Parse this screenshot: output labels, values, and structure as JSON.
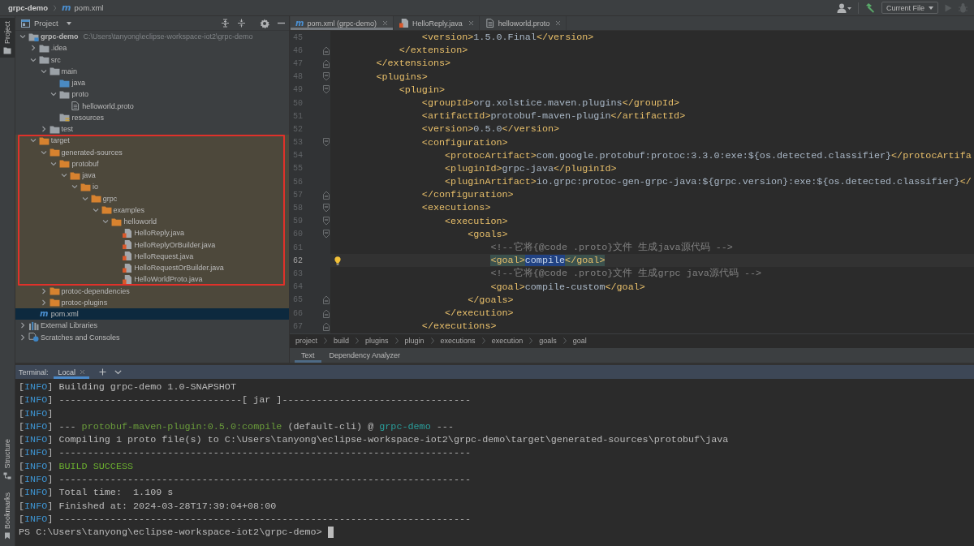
{
  "nav_bar": {
    "project": "grpc-demo",
    "file_glyph": "m",
    "file": "pom.xml",
    "run_configuration": "Current File"
  },
  "tool_stripe": {
    "top": [
      {
        "label": "Project",
        "kind": "project",
        "selected": true
      }
    ],
    "bottom": [
      {
        "label": "Structure",
        "kind": "structure",
        "selected": false
      },
      {
        "label": "Bookmarks",
        "kind": "bookmarks",
        "selected": false
      }
    ]
  },
  "project_panel": {
    "title": "Project",
    "tree": [
      {
        "label": "grpc-demo",
        "kind": "module",
        "hint": "C:\\Users\\tanyong\\eclipse-workspace-iot2\\grpc-demo",
        "expanded": true,
        "selected": false,
        "outlined": false,
        "children": [
          {
            "label": ".idea",
            "kind": "folder",
            "expanded": false,
            "selected": false,
            "outlined": false
          },
          {
            "label": "src",
            "kind": "folder",
            "expanded": true,
            "selected": false,
            "outlined": false,
            "children": [
              {
                "label": "main",
                "kind": "folder",
                "expanded": true,
                "selected": false,
                "outlined": false,
                "children": [
                  {
                    "label": "java",
                    "kind": "source_folder",
                    "selected": false,
                    "outlined": false
                  },
                  {
                    "label": "proto",
                    "kind": "folder",
                    "expanded": true,
                    "selected": false,
                    "outlined": false,
                    "children": [
                      {
                        "label": "helloworld.proto",
                        "kind": "proto_file",
                        "selected": false,
                        "outlined": false
                      }
                    ]
                  },
                  {
                    "label": "resources",
                    "kind": "resource_folder",
                    "selected": false,
                    "outlined": false
                  }
                ]
              },
              {
                "label": "test",
                "kind": "folder",
                "expanded": false,
                "selected": false,
                "outlined": false
              }
            ]
          },
          {
            "label": "target",
            "kind": "excluded_folder",
            "expanded": true,
            "selected": false,
            "outlined": true,
            "children": [
              {
                "label": "generated-sources",
                "kind": "folder",
                "expanded": true,
                "selected": false,
                "outlined": true,
                "children": [
                  {
                    "label": "protobuf",
                    "kind": "folder",
                    "expanded": true,
                    "selected": false,
                    "outlined": true,
                    "children": [
                      {
                        "label": "java",
                        "kind": "folder",
                        "expanded": true,
                        "selected": false,
                        "outlined": true,
                        "children": [
                          {
                            "label": "io",
                            "kind": "folder",
                            "expanded": true,
                            "selected": false,
                            "outlined": true,
                            "children": [
                              {
                                "label": "grpc",
                                "kind": "folder",
                                "expanded": true,
                                "selected": false,
                                "outlined": true,
                                "children": [
                                  {
                                    "label": "examples",
                                    "kind": "folder",
                                    "expanded": true,
                                    "selected": false,
                                    "outlined": true,
                                    "children": [
                                      {
                                        "label": "helloworld",
                                        "kind": "folder",
                                        "expanded": true,
                                        "selected": false,
                                        "outlined": true,
                                        "children": [
                                          {
                                            "label": "HelloReply.java",
                                            "kind": "java_file",
                                            "selected": false,
                                            "outlined": true
                                          },
                                          {
                                            "label": "HelloReplyOrBuilder.java",
                                            "kind": "java_file",
                                            "selected": false,
                                            "outlined": true
                                          },
                                          {
                                            "label": "HelloRequest.java",
                                            "kind": "java_file",
                                            "selected": false,
                                            "outlined": true
                                          },
                                          {
                                            "label": "HelloRequestOrBuilder.java",
                                            "kind": "java_file",
                                            "selected": false,
                                            "outlined": true
                                          },
                                          {
                                            "label": "HelloWorldProto.java",
                                            "kind": "java_file",
                                            "selected": false,
                                            "outlined": true
                                          }
                                        ]
                                      }
                                    ]
                                  }
                                ]
                              }
                            ]
                          }
                        ]
                      }
                    ]
                  }
                ]
              },
              {
                "label": "protoc-dependencies",
                "kind": "folder",
                "expanded": false,
                "selected": false,
                "outlined": false
              },
              {
                "label": "protoc-plugins",
                "kind": "folder",
                "expanded": false,
                "selected": false,
                "outlined": false
              }
            ]
          },
          {
            "label": "pom.xml",
            "kind": "maven_file",
            "glyph": "m",
            "selected": true,
            "outlined": false
          }
        ]
      },
      {
        "label": "External Libraries",
        "kind": "libraries",
        "expanded": false,
        "selected": false,
        "outlined": false
      },
      {
        "label": "Scratches and Consoles",
        "kind": "scratches",
        "expanded": false,
        "selected": false,
        "outlined": false
      }
    ]
  },
  "editor": {
    "tabs": [
      {
        "label": "pom.xml (grpc-demo)",
        "kind": "maven",
        "glyph": "m",
        "selected": true
      },
      {
        "label": "HelloReply.java",
        "kind": "java",
        "selected": false
      },
      {
        "label": "helloworld.proto",
        "kind": "proto",
        "selected": false
      }
    ],
    "lines": [
      {
        "number": "45",
        "kind": "plain",
        "current": false,
        "tokens": [
          {
            "kind": "tag",
            "text": "                <version>"
          },
          {
            "kind": "value",
            "text": "1.5.0.Final"
          },
          {
            "kind": "tag",
            "text": "</version>"
          }
        ]
      },
      {
        "number": "46",
        "kind": "fold_end",
        "current": false,
        "tokens": [
          {
            "kind": "tag",
            "text": "            </extension>"
          }
        ]
      },
      {
        "number": "47",
        "kind": "fold_end",
        "current": false,
        "tokens": [
          {
            "kind": "tag",
            "text": "        </extensions>"
          }
        ]
      },
      {
        "number": "48",
        "kind": "fold_start",
        "current": false,
        "tokens": [
          {
            "kind": "tag",
            "text": "        <plugins>"
          }
        ]
      },
      {
        "number": "49",
        "kind": "fold_start",
        "current": false,
        "tokens": [
          {
            "kind": "tag",
            "text": "            <plugin>"
          }
        ]
      },
      {
        "number": "50",
        "kind": "plain",
        "current": false,
        "tokens": [
          {
            "kind": "tag",
            "text": "                <groupId>"
          },
          {
            "kind": "value",
            "text": "org.xolstice.maven.plugins"
          },
          {
            "kind": "tag",
            "text": "</groupId>"
          }
        ]
      },
      {
        "number": "51",
        "kind": "plain",
        "current": false,
        "tokens": [
          {
            "kind": "tag",
            "text": "                <artifactId>"
          },
          {
            "kind": "value",
            "text": "protobuf-maven-plugin"
          },
          {
            "kind": "tag",
            "text": "</artifactId>"
          }
        ]
      },
      {
        "number": "52",
        "kind": "plain",
        "current": false,
        "tokens": [
          {
            "kind": "tag",
            "text": "                <version>"
          },
          {
            "kind": "value",
            "text": "0.5.0"
          },
          {
            "kind": "tag",
            "text": "</version>"
          }
        ]
      },
      {
        "number": "53",
        "kind": "fold_start",
        "current": false,
        "tokens": [
          {
            "kind": "tag",
            "text": "                <configuration>"
          }
        ]
      },
      {
        "number": "54",
        "kind": "plain",
        "current": false,
        "tokens": [
          {
            "kind": "tag",
            "text": "                    <protocArtifact>"
          },
          {
            "kind": "value",
            "text": "com.google.protobuf:protoc:3.3.0:exe:${os.detected.classifier}"
          },
          {
            "kind": "tag",
            "text": "</protocArtifa"
          }
        ]
      },
      {
        "number": "55",
        "kind": "plain",
        "current": false,
        "tokens": [
          {
            "kind": "tag",
            "text": "                    <pluginId>"
          },
          {
            "kind": "value",
            "text": "grpc-java"
          },
          {
            "kind": "tag",
            "text": "</pluginId>"
          }
        ]
      },
      {
        "number": "56",
        "kind": "plain",
        "current": false,
        "tokens": [
          {
            "kind": "tag",
            "text": "                    <pluginArtifact>"
          },
          {
            "kind": "value",
            "text": "io.grpc:protoc-gen-grpc-java:${grpc.version}:exe:${os.detected.classifier}"
          },
          {
            "kind": "tag",
            "text": "</"
          }
        ]
      },
      {
        "number": "57",
        "kind": "fold_end",
        "current": false,
        "tokens": [
          {
            "kind": "tag",
            "text": "                </configuration>"
          }
        ]
      },
      {
        "number": "58",
        "kind": "fold_start",
        "current": false,
        "tokens": [
          {
            "kind": "tag",
            "text": "                <executions>"
          }
        ]
      },
      {
        "number": "59",
        "kind": "fold_start",
        "current": false,
        "tokens": [
          {
            "kind": "tag",
            "text": "                    <execution>"
          }
        ]
      },
      {
        "number": "60",
        "kind": "fold_start",
        "current": false,
        "tokens": [
          {
            "kind": "tag",
            "text": "                        <goals>"
          }
        ]
      },
      {
        "number": "61",
        "kind": "plain",
        "current": false,
        "tokens": [
          {
            "kind": "comment",
            "text": "                            <!--它将{@code .proto}文件 生成java源代码 -->"
          }
        ]
      },
      {
        "number": "62",
        "kind": "plain",
        "current": true,
        "tokens": [
          {
            "kind": "tag_match",
            "text": "                            <goal>"
          },
          {
            "kind": "selection",
            "text": "compile"
          },
          {
            "kind": "tag_match",
            "text": "</goal>"
          }
        ]
      },
      {
        "number": "63",
        "kind": "plain",
        "current": false,
        "tokens": [
          {
            "kind": "comment",
            "text": "                            <!--它将{@code .proto}文件 生成grpc java源代码 -->"
          }
        ]
      },
      {
        "number": "64",
        "kind": "plain",
        "current": false,
        "tokens": [
          {
            "kind": "tag",
            "text": "                            <goal>"
          },
          {
            "kind": "value",
            "text": "compile-custom"
          },
          {
            "kind": "tag",
            "text": "</goal>"
          }
        ]
      },
      {
        "number": "65",
        "kind": "fold_end",
        "current": false,
        "tokens": [
          {
            "kind": "tag",
            "text": "                        </goals>"
          }
        ]
      },
      {
        "number": "66",
        "kind": "fold_end",
        "current": false,
        "tokens": [
          {
            "kind": "tag",
            "text": "                    </execution>"
          }
        ]
      },
      {
        "number": "67",
        "kind": "fold_end",
        "current": false,
        "tokens": [
          {
            "kind": "tag",
            "text": "                </executions>"
          }
        ]
      }
    ],
    "breadcrumbs": [
      "project",
      "build",
      "plugins",
      "plugin",
      "executions",
      "execution",
      "goals",
      "goal"
    ],
    "view_tabs": [
      {
        "label": "Text",
        "selected": true
      },
      {
        "label": "Dependency Analyzer",
        "selected": false
      }
    ]
  },
  "terminal": {
    "title": "Terminal:",
    "tabs": [
      {
        "label": "Local",
        "selected": true
      }
    ],
    "lines": [
      {
        "cursor": false,
        "tokens": [
          {
            "kind": "plain",
            "text": "["
          },
          {
            "kind": "level",
            "text": "INFO"
          },
          {
            "kind": "plain",
            "text": "] Building grpc-demo 1.0-SNAPSHOT"
          }
        ]
      },
      {
        "cursor": false,
        "tokens": [
          {
            "kind": "plain",
            "text": "["
          },
          {
            "kind": "level",
            "text": "INFO"
          },
          {
            "kind": "plain",
            "text": "] --------------------------------[ jar ]---------------------------------"
          }
        ]
      },
      {
        "cursor": false,
        "tokens": [
          {
            "kind": "plain",
            "text": "["
          },
          {
            "kind": "level",
            "text": "INFO"
          },
          {
            "kind": "plain",
            "text": "]"
          }
        ]
      },
      {
        "cursor": false,
        "tokens": [
          {
            "kind": "plain",
            "text": "["
          },
          {
            "kind": "level",
            "text": "INFO"
          },
          {
            "kind": "plain",
            "text": "] --- "
          },
          {
            "kind": "plugin",
            "text": "protobuf-maven-plugin:0.5.0:compile"
          },
          {
            "kind": "plain",
            "text": " (default-cli) @ "
          },
          {
            "kind": "project",
            "text": "grpc-demo"
          },
          {
            "kind": "plain",
            "text": " ---"
          }
        ]
      },
      {
        "cursor": false,
        "tokens": [
          {
            "kind": "plain",
            "text": "["
          },
          {
            "kind": "level",
            "text": "INFO"
          },
          {
            "kind": "plain",
            "text": "] Compiling 1 proto file(s) to C:\\Users\\tanyong\\eclipse-workspace-iot2\\grpc-demo\\target\\generated-sources\\protobuf\\java"
          }
        ]
      },
      {
        "cursor": false,
        "tokens": [
          {
            "kind": "plain",
            "text": "["
          },
          {
            "kind": "level",
            "text": "INFO"
          },
          {
            "kind": "plain",
            "text": "] ------------------------------------------------------------------------"
          }
        ]
      },
      {
        "cursor": false,
        "tokens": [
          {
            "kind": "plain",
            "text": "["
          },
          {
            "kind": "level",
            "text": "INFO"
          },
          {
            "kind": "plain",
            "text": "] "
          },
          {
            "kind": "success",
            "text": "BUILD SUCCESS"
          }
        ]
      },
      {
        "cursor": false,
        "tokens": [
          {
            "kind": "plain",
            "text": "["
          },
          {
            "kind": "level",
            "text": "INFO"
          },
          {
            "kind": "plain",
            "text": "] ------------------------------------------------------------------------"
          }
        ]
      },
      {
        "cursor": false,
        "tokens": [
          {
            "kind": "plain",
            "text": "["
          },
          {
            "kind": "level",
            "text": "INFO"
          },
          {
            "kind": "plain",
            "text": "] Total time:  1.109 s"
          }
        ]
      },
      {
        "cursor": false,
        "tokens": [
          {
            "kind": "plain",
            "text": "["
          },
          {
            "kind": "level",
            "text": "INFO"
          },
          {
            "kind": "plain",
            "text": "] Finished at: 2024-03-28T17:39:04+08:00"
          }
        ]
      },
      {
        "cursor": false,
        "tokens": [
          {
            "kind": "plain",
            "text": "["
          },
          {
            "kind": "level",
            "text": "INFO"
          },
          {
            "kind": "plain",
            "text": "] ------------------------------------------------------------------------"
          }
        ]
      },
      {
        "cursor": true,
        "tokens": [
          {
            "kind": "plain",
            "text": "PS C:\\Users\\tanyong\\eclipse-workspace-iot2\\grpc-demo>"
          }
        ]
      }
    ]
  }
}
